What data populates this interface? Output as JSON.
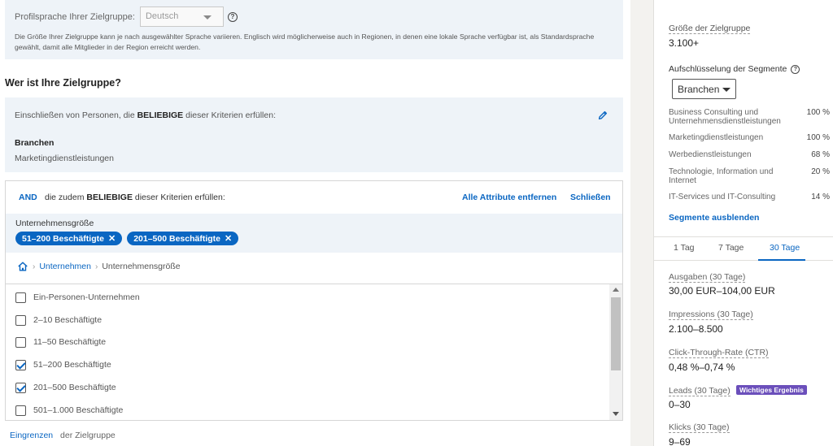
{
  "language": {
    "label": "Profilsprache Ihrer Zielgruppe:",
    "selected": "Deutsch",
    "help_icon": "?",
    "description": "Die Größe Ihrer Zielgruppe kann je nach ausgewählter Sprache variieren. Englisch wird möglicherweise auch in Regionen, in denen eine lokale Sprache verfügbar ist, als Standardsprache gewählt, damit alle Mitglieder in der Region erreicht werden."
  },
  "section_title": "Wer ist Ihre Zielgruppe?",
  "include": {
    "text_before": "Einschließen von Personen, die ",
    "text_bold": "BELIEBIGE",
    "text_after": " dieser Kriterien erfüllen:",
    "criterion_title": "Branchen",
    "criterion_value": "Marketingdienstleistungen"
  },
  "and_block": {
    "and_word": "AND",
    "text_before": "die zudem ",
    "text_bold": "BELIEBIGE",
    "text_after": " dieser Kriterien erfüllen:",
    "remove_all": "Alle Attribute entfernen",
    "close": "Schließen",
    "size_label": "Unternehmensgröße",
    "chips": [
      {
        "label": "51–200 Beschäftigte",
        "x": "✕"
      },
      {
        "label": "201–500 Beschäftigte",
        "x": "✕"
      }
    ],
    "breadcrumb": {
      "sep": "›",
      "link": "Unternehmen",
      "current": "Unternehmensgröße"
    },
    "options": [
      {
        "label": "Ein-Personen-Unternehmen",
        "checked": false
      },
      {
        "label": "2–10 Beschäftigte",
        "checked": false
      },
      {
        "label": "11–50 Beschäftigte",
        "checked": false
      },
      {
        "label": "51–200 Beschäftigte",
        "checked": true
      },
      {
        "label": "201–500 Beschäftigte",
        "checked": true
      },
      {
        "label": "501–1.000 Beschäftigte",
        "checked": false
      }
    ]
  },
  "narrow": {
    "link": "Eingrenzen",
    "text": "der Zielgruppe"
  },
  "right_panel": {
    "size_title": "Größe der Zielgruppe",
    "size_value": "3.100+",
    "segments_title": "Aufschlüsselung der Segmente",
    "segments_select": "Branchen",
    "segments": [
      {
        "label": "Business Consulting und Unternehmensdienstleistungen",
        "pct": "100 %"
      },
      {
        "label": "Marketingdienstleistungen",
        "pct": "100 %"
      },
      {
        "label": "Werbedienstleistungen",
        "pct": "68 %"
      },
      {
        "label": "Technologie, Information und Internet",
        "pct": "20 %"
      },
      {
        "label": "IT-Services und IT-Consulting",
        "pct": "14 %"
      }
    ],
    "hide_segments": "Segmente ausblenden",
    "tabs": [
      "1 Tag",
      "7 Tage",
      "30 Tage"
    ],
    "active_tab": "30 Tage",
    "metrics": [
      {
        "label": "Ausgaben (30 Tage)",
        "value": "30,00 EUR–104,00 EUR"
      },
      {
        "label": "Impressions (30 Tage)",
        "value": "2.100–8.500"
      },
      {
        "label": "Click-Through-Rate (CTR)",
        "value": "0,48 %–0,74 %"
      },
      {
        "label": "Leads (30 Tage)",
        "value": "0–30"
      },
      {
        "label": "Klicks (30 Tage)",
        "value": "9–69"
      }
    ],
    "badge": "Wichtiges Ergebnis"
  },
  "colors": {
    "accent": "#0a66c2",
    "panel_bg": "#eef3f8",
    "badge": "#6b4fbb"
  }
}
